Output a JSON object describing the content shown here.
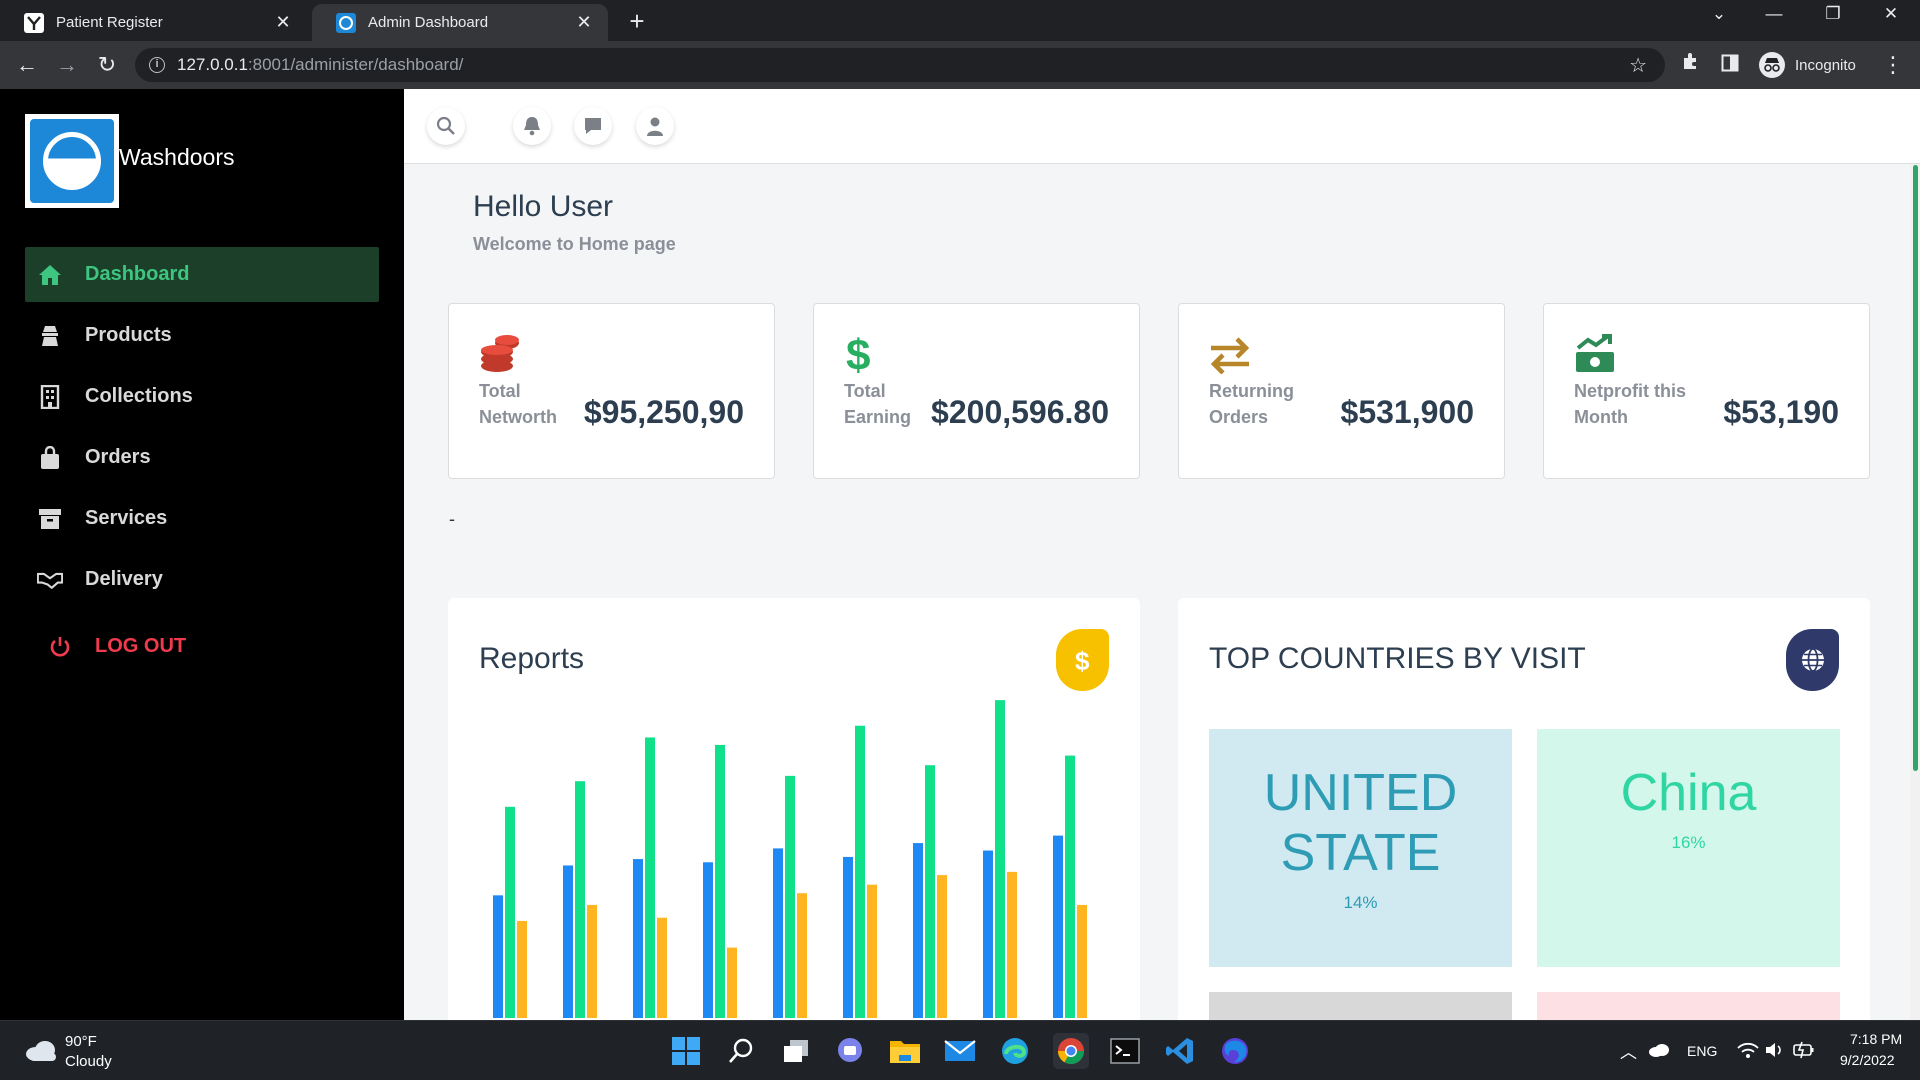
{
  "browser": {
    "tabs": [
      {
        "title": "Patient Register",
        "active": false
      },
      {
        "title": "Admin Dashboard",
        "active": true
      }
    ],
    "url_host": "127.0.0.1",
    "url_rest": ":8001/administer/dashboard/",
    "profile_label": "Incognito"
  },
  "sidebar": {
    "brand": "Washdoors",
    "items": [
      {
        "label": "Dashboard",
        "icon": "home-icon",
        "active": true
      },
      {
        "label": "Products",
        "icon": "products-icon",
        "active": false
      },
      {
        "label": "Collections",
        "icon": "building-icon",
        "active": false
      },
      {
        "label": "Orders",
        "icon": "shopping-bag-icon",
        "active": false
      },
      {
        "label": "Services",
        "icon": "archive-box-icon",
        "active": false
      },
      {
        "label": "Delivery",
        "icon": "handshake-icon",
        "active": false
      }
    ],
    "logout_label": "LOG OUT"
  },
  "header": {
    "greeting": "Hello User",
    "subtitle": "Welcome to Home page"
  },
  "stats": [
    {
      "label": "Total Networth",
      "value": "$95,250,90",
      "icon": "coins-icon",
      "color": "#c0392b"
    },
    {
      "label": "Total Earning",
      "value": "$200,596.80",
      "icon": "dollar-icon",
      "color": "#27ae60"
    },
    {
      "label": "Returning Orders",
      "value": "$531,900",
      "icon": "exchange-arrows-icon",
      "color": "#b7862a"
    },
    {
      "label": "Netprofit this Month",
      "value": "$53,190",
      "icon": "money-growth-icon",
      "color": "#2e8b57"
    }
  ],
  "stray_text": "-",
  "reports": {
    "title": "Reports",
    "badge_icon": "dollar-icon",
    "badge_color": "#f7c100"
  },
  "chart_data": {
    "type": "bar",
    "title": "Reports",
    "categories": [
      "",
      "",
      "",
      "",
      "",
      "",
      "",
      "",
      ""
    ],
    "series": [
      {
        "color": "#1e88f5",
        "values": [
          115,
          143,
          149,
          146,
          159,
          151,
          164,
          157,
          171
        ]
      },
      {
        "color": "#10e08a",
        "values": [
          198,
          222,
          263,
          256,
          227,
          274,
          237,
          298,
          246
        ]
      },
      {
        "color": "#ffb51f",
        "values": [
          91,
          106,
          94,
          66,
          117,
          125,
          134,
          137,
          106
        ]
      }
    ],
    "ylim": [
      0,
      300
    ],
    "grid": false,
    "legend": "none"
  },
  "countries": {
    "title": "TOP COUNTRIES BY VISIT",
    "badge_icon": "globe-icon",
    "badge_color": "#2f3a6b",
    "items": [
      {
        "name": "UNITED STATE",
        "percent": "14%",
        "bg": "#d1e9f0",
        "fg": "#2e9cb5"
      },
      {
        "name": "China",
        "percent": "16%",
        "bg": "#d3f7ea",
        "fg": "#2fd6a3"
      }
    ]
  },
  "taskbar": {
    "weather_temp": "90°F",
    "weather_cond": "Cloudy",
    "lang": "ENG",
    "time": "7:18 PM",
    "date": "9/2/2022"
  }
}
